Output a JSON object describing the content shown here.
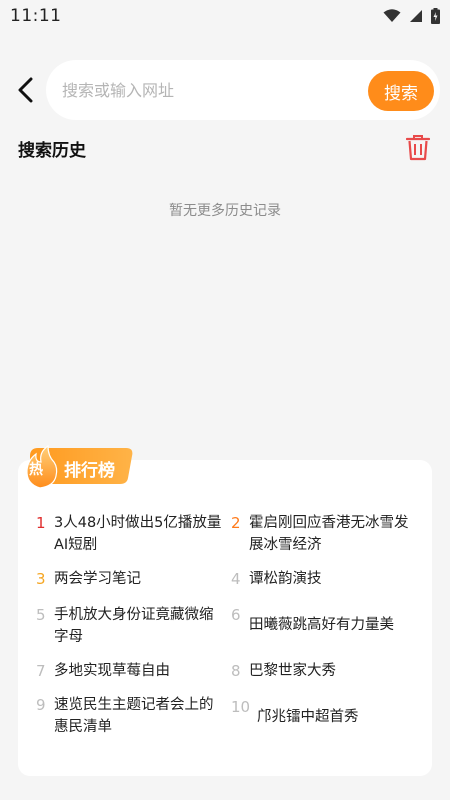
{
  "status_bar": {
    "time": "11:11"
  },
  "search": {
    "placeholder": "搜索或输入网址",
    "button_label": "搜索"
  },
  "history": {
    "title": "搜索历史",
    "empty_text": "暂无更多历史记录"
  },
  "ranking": {
    "tab_badge": "热",
    "tab_label": "排行榜",
    "items": [
      {
        "rank": "1",
        "text_lines": [
          "3人48小时做出5亿播放量",
          "AI短剧"
        ],
        "color": "#e02e2e"
      },
      {
        "rank": "2",
        "text_lines": [
          "霍启刚回应香港无冰雪发",
          "展冰雪经济"
        ],
        "color": "#ff7a1a"
      },
      {
        "rank": "3",
        "text_lines": [
          "两会学习笔记"
        ],
        "color": "#f5a623"
      },
      {
        "rank": "4",
        "text_lines": [
          "谭松韵演技"
        ],
        "color": "#bdbdbd"
      },
      {
        "rank": "5",
        "text_lines": [
          "手机放大身份证竟藏微缩",
          "字母"
        ],
        "color": "#bdbdbd"
      },
      {
        "rank": "6",
        "text_lines": [
          "田曦薇跳高好有力量美"
        ],
        "color": "#bdbdbd"
      },
      {
        "rank": "7",
        "text_lines": [
          "多地实现草莓自由"
        ],
        "color": "#bdbdbd"
      },
      {
        "rank": "8",
        "text_lines": [
          "巴黎世家大秀"
        ],
        "color": "#bdbdbd"
      },
      {
        "rank": "9",
        "text_lines": [
          "速览民生主题记者会上的",
          "惠民清单"
        ],
        "color": "#bdbdbd"
      },
      {
        "rank": "10",
        "text_lines": [
          "邝兆镭中超首秀"
        ],
        "color": "#bdbdbd"
      }
    ]
  },
  "colors": {
    "accent": "#ff8c1a",
    "trash": "#e84a4a",
    "background": "#f5f5f5"
  }
}
